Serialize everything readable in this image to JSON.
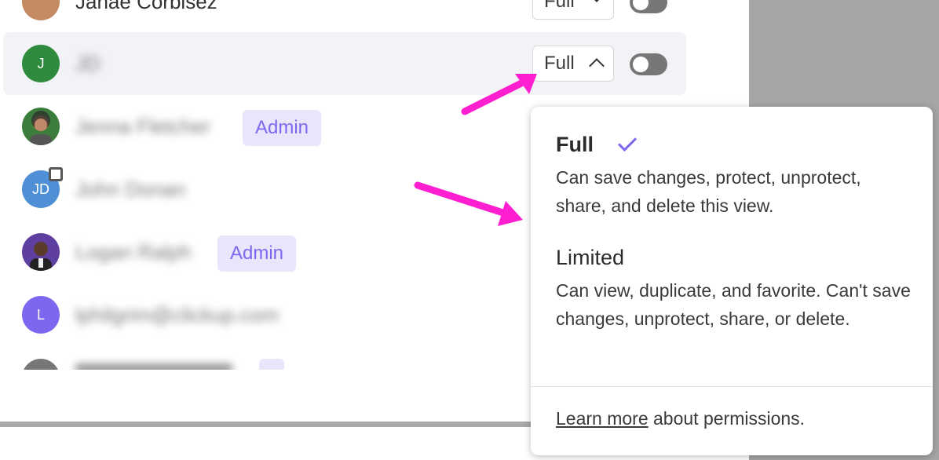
{
  "rows": [
    {
      "name": "Janae Corbisez",
      "permission": "Full"
    },
    {
      "avatar_letter": "J",
      "name": "JD",
      "permission": "Full"
    },
    {
      "name": "Jenna Fletcher",
      "badge": "Admin"
    },
    {
      "avatar_letter": "JD",
      "name": "John Donan"
    },
    {
      "name": "Logan Ralph",
      "badge": "Admin"
    },
    {
      "avatar_letter": "L",
      "name": "lphilgrim@clickup.com"
    }
  ],
  "dropdown": {
    "full_title": "Full",
    "full_desc": "Can save changes, protect, unprotect, share, and delete this view.",
    "limited_title": "Limited",
    "limited_desc": "Can view, duplicate, and favorite. Can't save changes, unprotect, share, or delete.",
    "learn_more": "Learn more",
    "footer_rest": " about permissions."
  },
  "colors": {
    "accent": "#7b68ee",
    "arrow": "#ff1fd1",
    "avatar_green": "#2e8b3e",
    "avatar_blue": "#4f8fd6",
    "avatar_purple": "#7b68ee"
  },
  "icons": {
    "check": "check-icon",
    "chevron_up": "chevron-up-icon",
    "chevron_down": "chevron-down-icon"
  }
}
